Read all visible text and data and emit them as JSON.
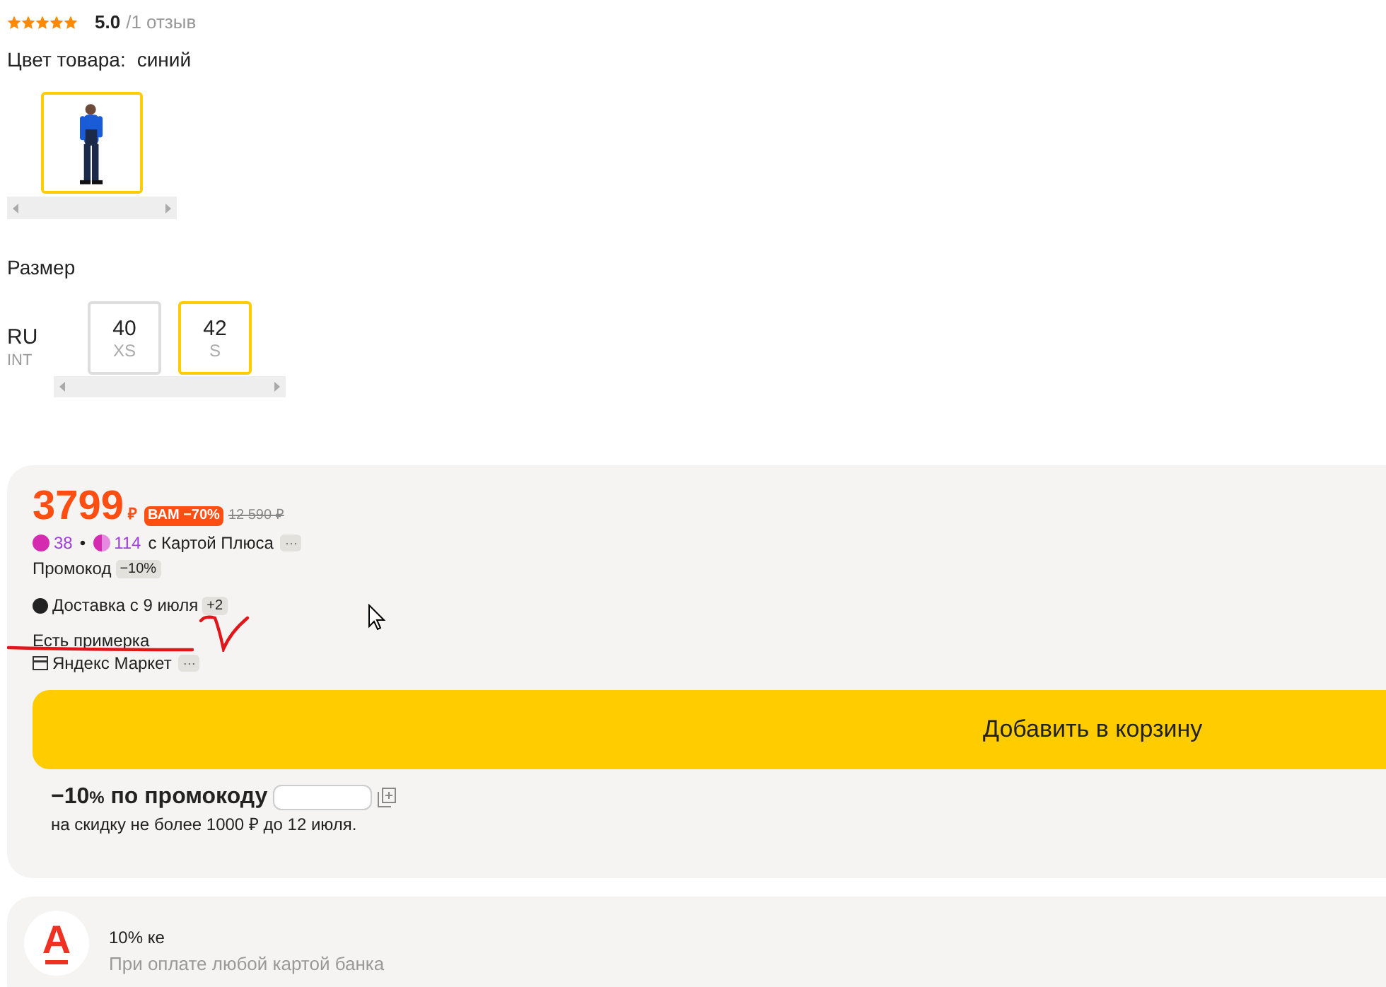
{
  "rating": {
    "stars": 5,
    "score": "5.0",
    "reviews": "/1 отзыв"
  },
  "color": {
    "label": "Цвет товара:",
    "value": "синий",
    "options": [
      {
        "kind": "picture",
        "selected": true
      }
    ]
  },
  "size": {
    "label": "Размер",
    "system": "RU",
    "system_alt": "INT",
    "options": [
      {
        "ru": "40",
        "int": "XS",
        "selected": false
      },
      {
        "ru": "42",
        "int": "S",
        "selected": true
      }
    ]
  },
  "offer": {
    "price": "3799",
    "currency": "₽",
    "discount_badge": "ВАМ −70%",
    "old_price": "12 590 ₽",
    "plus_points": "38",
    "separator": "•",
    "plus_points_card": "114",
    "plus_text": "с Картой Плюса",
    "more": "···",
    "promo_label": "Промокод",
    "promo_badge": "−10%",
    "delivery": "Доставка с 9 июля",
    "delivery_more": "+2",
    "fitting": "Есть примерка",
    "seller": "Яндекс Маркет",
    "seller_more": "···",
    "cart_button": "Добавить в корзину",
    "promo_title_bold": "−10",
    "promo_title_pct": "%",
    "promo_title_rest": "по промокоду",
    "promo_note": "на скидку не более 1000 ₽ до 12 июля."
  },
  "bank": {
    "logo": "А",
    "title": "10% ке",
    "subtitle": "При оплате любой картой банка"
  }
}
